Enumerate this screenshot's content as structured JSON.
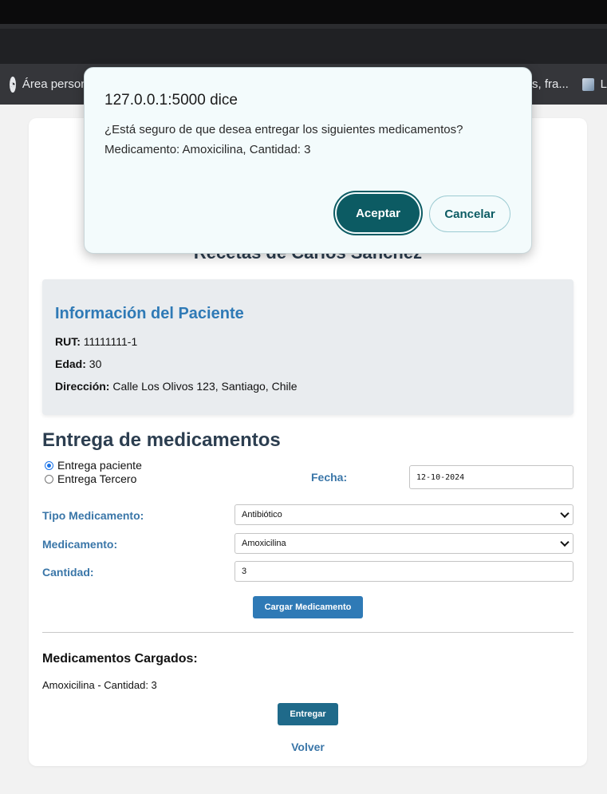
{
  "browser": {
    "bookmarks": [
      {
        "icon": "globe-icon",
        "label": "Área personal"
      },
      {
        "label": "s, fra..."
      },
      {
        "icon": "box-icon",
        "label": "L"
      }
    ]
  },
  "page": {
    "title": "Recetas de Carlos Sánchez",
    "patient": {
      "heading": "Información del Paciente",
      "rut_label": "RUT:",
      "rut_value": "11111111-1",
      "age_label": "Edad:",
      "age_value": "30",
      "address_label": "Dirección:",
      "address_value": "Calle Los Olivos 123, Santiago, Chile"
    },
    "delivery": {
      "heading": "Entrega de medicamentos",
      "radio_patient": "Entrega paciente",
      "radio_third": "Entrega Tercero",
      "selected_radio": "Entrega paciente",
      "date_label": "Fecha:",
      "date_value": "12-10-2024",
      "type_label": "Tipo Medicamento:",
      "type_value": "Antibiótico",
      "med_label": "Medicamento:",
      "med_value": "Amoxicilina",
      "qty_label": "Cantidad:",
      "qty_value": "3",
      "load_button": "Cargar Medicamento"
    },
    "loaded": {
      "heading": "Medicamentos Cargados:",
      "items": [
        "Amoxicilina - Cantidad: 3"
      ]
    },
    "deliver_button": "Entregar",
    "back_link": "Volver"
  },
  "dialog": {
    "title": "127.0.0.1:5000 dice",
    "message_line1": "¿Está seguro de que desea entregar los siguientes medicamentos?",
    "message_line2": "Medicamento: Amoxicilina, Cantidad: 3",
    "ok_label": "Aceptar",
    "cancel_label": "Cancelar"
  },
  "colors": {
    "accent_blue": "#2f7ab6",
    "button_blue": "#2f7ab6",
    "deliver_button": "#1f6a8a",
    "dialog_primary": "#0c5b63"
  }
}
